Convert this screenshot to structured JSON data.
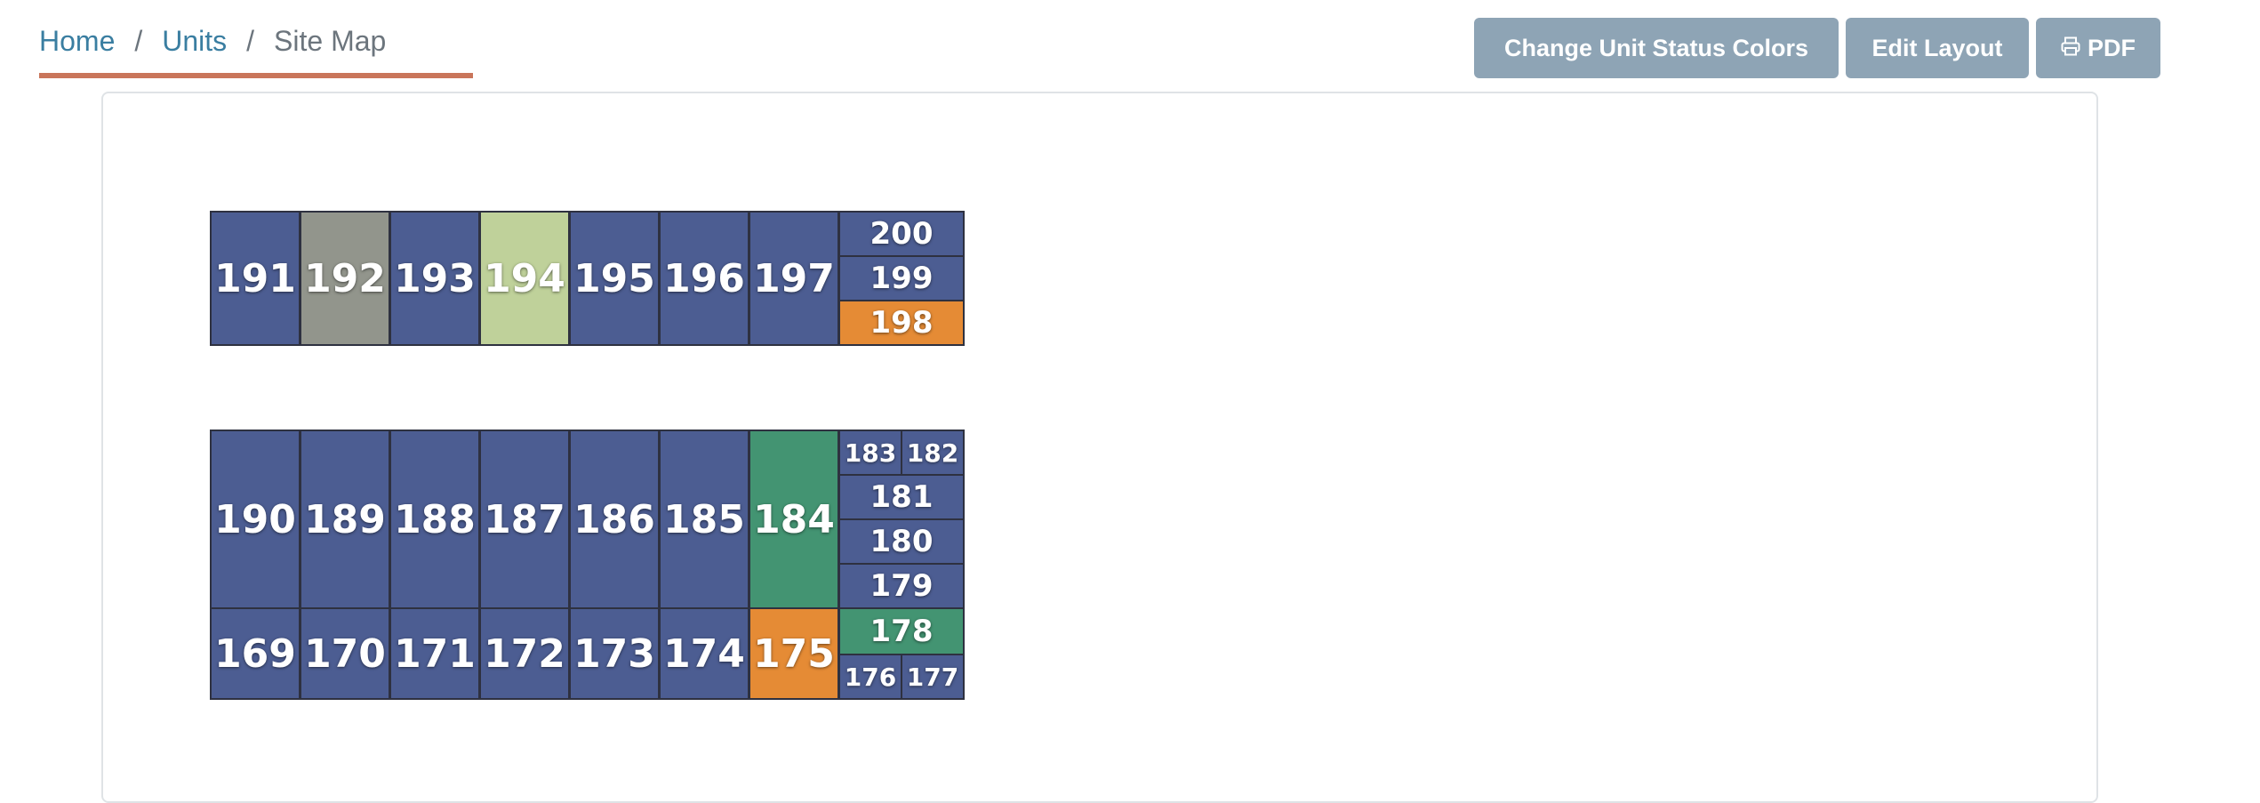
{
  "breadcrumb": {
    "home": "Home",
    "units": "Units",
    "current": "Site Map",
    "separator": "/"
  },
  "toolbar": {
    "change_colors": "Change Unit Status Colors",
    "edit_layout": "Edit Layout",
    "pdf": "PDF",
    "pdf_icon": "print-icon",
    "button_color": "#8ea4b5"
  },
  "status_colors": {
    "available": "#4c5d92",
    "gray": "#92958c",
    "light_green": "#bfd19a",
    "orange": "#e58b35",
    "green": "#439472"
  },
  "buildings": [
    {
      "units": [
        {
          "number": "191",
          "status": "available"
        },
        {
          "number": "192",
          "status": "gray"
        },
        {
          "number": "193",
          "status": "available"
        },
        {
          "number": "194",
          "status": "light_green"
        },
        {
          "number": "195",
          "status": "available"
        },
        {
          "number": "196",
          "status": "available"
        },
        {
          "number": "197",
          "status": "available"
        },
        {
          "number": "200",
          "status": "available"
        },
        {
          "number": "199",
          "status": "available"
        },
        {
          "number": "198",
          "status": "orange"
        }
      ]
    },
    {
      "units": [
        {
          "number": "190",
          "status": "available"
        },
        {
          "number": "189",
          "status": "available"
        },
        {
          "number": "188",
          "status": "available"
        },
        {
          "number": "187",
          "status": "available"
        },
        {
          "number": "186",
          "status": "available"
        },
        {
          "number": "185",
          "status": "available"
        },
        {
          "number": "184",
          "status": "green"
        },
        {
          "number": "183",
          "status": "available"
        },
        {
          "number": "182",
          "status": "available"
        },
        {
          "number": "181",
          "status": "available"
        },
        {
          "number": "180",
          "status": "available"
        },
        {
          "number": "179",
          "status": "available"
        },
        {
          "number": "169",
          "status": "available"
        },
        {
          "number": "170",
          "status": "available"
        },
        {
          "number": "171",
          "status": "available"
        },
        {
          "number": "172",
          "status": "available"
        },
        {
          "number": "173",
          "status": "available"
        },
        {
          "number": "174",
          "status": "available"
        },
        {
          "number": "175",
          "status": "orange"
        },
        {
          "number": "178",
          "status": "green"
        },
        {
          "number": "176",
          "status": "available"
        },
        {
          "number": "177",
          "status": "available"
        }
      ]
    }
  ]
}
